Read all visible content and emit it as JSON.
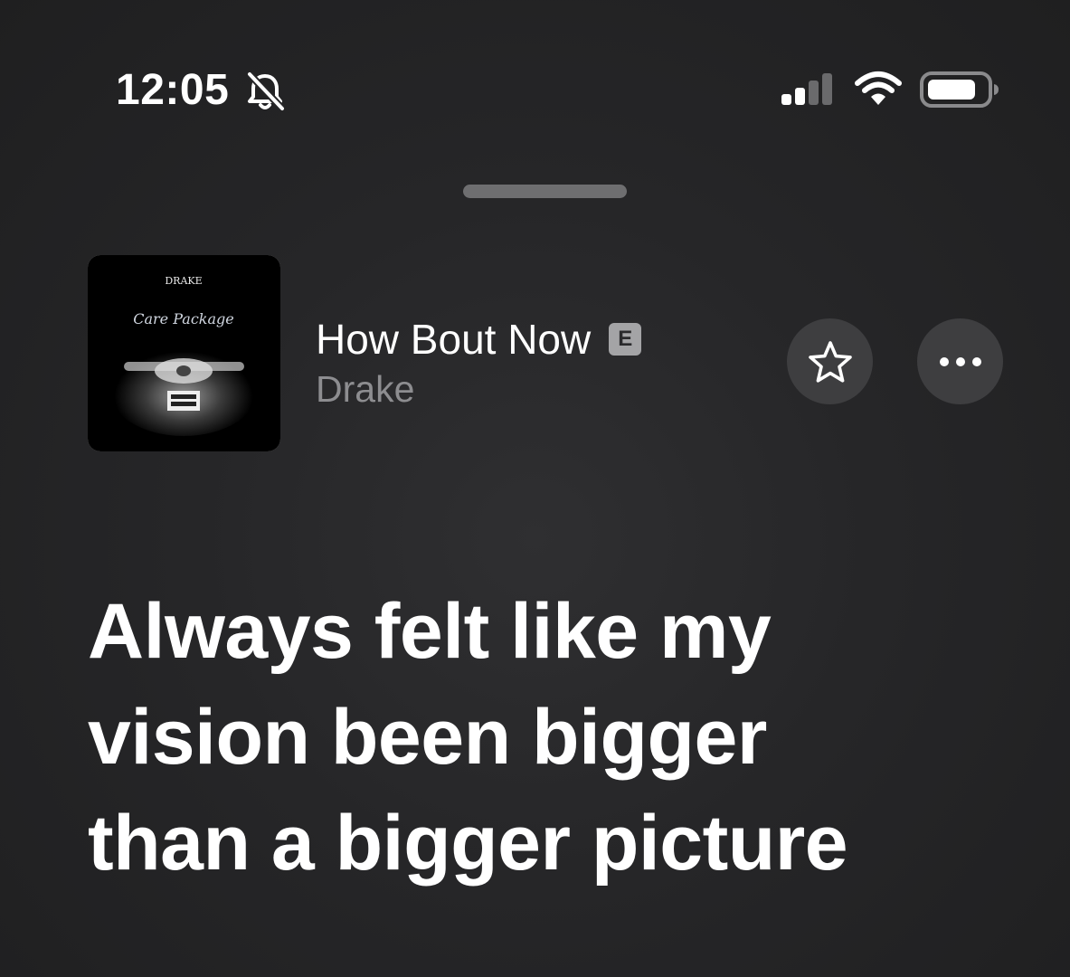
{
  "status_bar": {
    "time": "12:05",
    "silent_icon": "bell-slash-icon",
    "cellular_icon": "cellular-signal-icon",
    "wifi_icon": "wifi-icon",
    "battery_icon": "battery-icon"
  },
  "now_playing": {
    "artwork": {
      "artist_text": "DRAKE",
      "album_text": "Care Package"
    },
    "title": "How Bout Now",
    "explicit_badge": "E",
    "artist": "Drake",
    "favorite_icon": "star-icon",
    "more_icon": "ellipsis-icon"
  },
  "lyrics": {
    "lines": [
      "Always felt like my",
      "vision been bigger",
      "than a bigger picture"
    ]
  },
  "colors": {
    "background": "#262628",
    "primary_text": "#ffffff",
    "secondary_text": "#8d8d90",
    "button_background": "#3e3e40",
    "grabber": "#6e6e70"
  }
}
